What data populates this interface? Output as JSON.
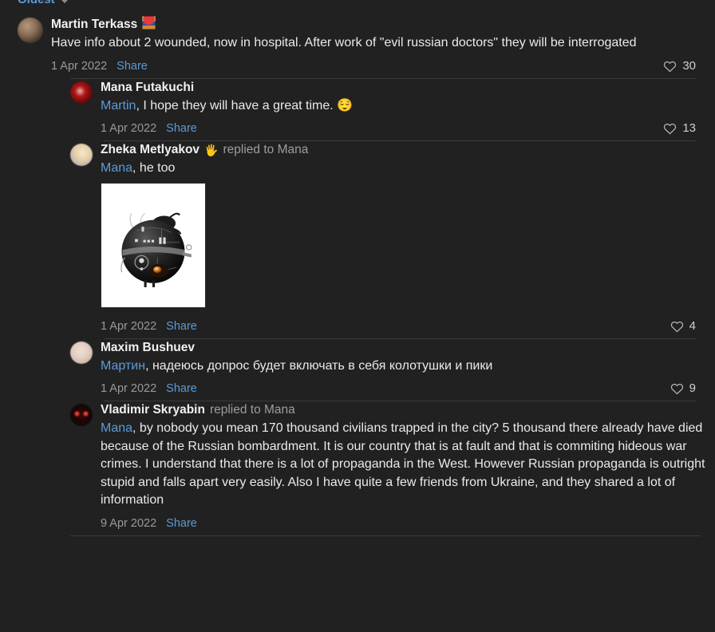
{
  "sort_control": {
    "label": "Oldest",
    "caret_icon": "chevron-down-icon"
  },
  "colors": {
    "background": "#212121",
    "text": "#eaeaea",
    "link": "#5b9bd5",
    "muted": "#9a9a9a",
    "divider": "#3b3b3b"
  },
  "share_label": "Share",
  "comments": [
    {
      "id": "c1",
      "level": 0,
      "avatar": "av-martin",
      "author": "Martin Terkass",
      "badge": "emoji-badge",
      "reply_to": "",
      "mention": "",
      "text": "Have info about 2 wounded, now in hospital. After work of \"evil russian doctors\" they will be interrogated",
      "emoji": "",
      "attachment": "",
      "timestamp": "1 Apr 2022",
      "share": "Share",
      "likes": 30,
      "like_icon": "heart-outline-icon"
    },
    {
      "id": "c2",
      "level": 1,
      "avatar": "av-mana",
      "author": "Mana Futakuchi",
      "badge": "",
      "reply_to": "",
      "mention": "Martin",
      "text": ", I hope they will have a great time. ",
      "emoji": "😌",
      "attachment": "",
      "timestamp": "1 Apr 2022",
      "share": "Share",
      "likes": 13,
      "like_icon": "heart-outline-icon"
    },
    {
      "id": "c3",
      "level": 1,
      "avatar": "av-zheka",
      "author": "Zheka Metlyakov",
      "badge": "hand-emoji",
      "reply_to": "replied to Mana",
      "mention": "Mana",
      "text": ", he too",
      "emoji": "",
      "attachment": "interrogation-droid-photo",
      "timestamp": "1 Apr 2022",
      "share": "Share",
      "likes": 4,
      "like_icon": "heart-outline-icon"
    },
    {
      "id": "c4",
      "level": 1,
      "avatar": "av-maxim",
      "author": "Maxim Bushuev",
      "badge": "",
      "reply_to": "",
      "mention": "Мартин",
      "text": ", надеюсь допрос будет включать в себя колотушки и пики",
      "emoji": "",
      "attachment": "",
      "timestamp": "1 Apr 2022",
      "share": "Share",
      "likes": 9,
      "like_icon": "heart-outline-icon"
    },
    {
      "id": "c5",
      "level": 1,
      "avatar": "av-vladimir",
      "author": "Vladimir Skryabin",
      "badge": "",
      "reply_to": "replied to Mana",
      "mention": "Mana",
      "text": ", by nobody you mean 170 thousand civilians trapped in the city? 5 thousand there already have died because of the Russian bombardment. It is our country that is at fault and that is commiting hideous war crimes. I understand that there is a lot of propaganda in the West. However Russian propaganda is outright stupid and falls apart very easily. Also I have quite a few friends from Ukraine, and they shared a lot of information",
      "emoji": "",
      "attachment": "",
      "timestamp": "9 Apr 2022",
      "share": "Share",
      "likes": null,
      "like_icon": ""
    }
  ]
}
